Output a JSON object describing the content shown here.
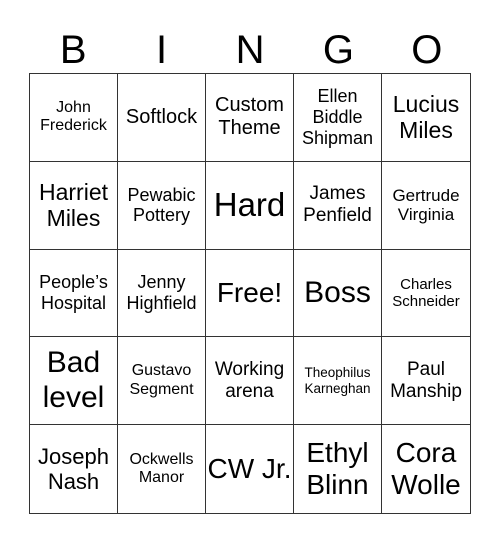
{
  "header": [
    "B",
    "I",
    "N",
    "G",
    "O"
  ],
  "rows": [
    [
      "John Frederick",
      "Softlock",
      "Custom Theme",
      "Ellen Biddle Shipman",
      "Lucius Miles"
    ],
    [
      "Harriet Miles",
      "Pewabic Pottery",
      "Hard",
      "James Penfield",
      "Gertrude Virginia"
    ],
    [
      "People’s Hospital",
      "Jenny Highfield",
      "Free!",
      "Boss",
      "Charles Schneider"
    ],
    [
      "Bad level",
      "Gustavo Segment",
      "Working arena",
      "Theophilus Karneghan",
      "Paul Manship"
    ],
    [
      "Joseph Nash",
      "Ockwells Manor",
      "CW Jr.",
      "Ethyl Blinn",
      "Cora Wolle"
    ]
  ],
  "free_space": "Free!"
}
